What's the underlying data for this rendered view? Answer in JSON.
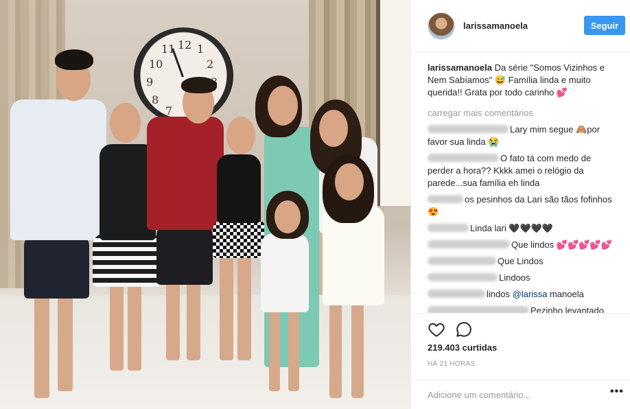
{
  "header": {
    "username": "larissamanoela",
    "follow_label": "Seguir"
  },
  "post": {
    "caption_user": "larissamanoela",
    "caption_text": "Da série \"Somos Vizinhos e Nem Sabíamos\" 😅 Família linda e muito querida!! Grata por todo carinho 💕",
    "load_more": "carregar mais comentários",
    "comments": [
      {
        "text": "Lary mim segue 🙈por favor sua linda 😭"
      },
      {
        "text": "O fato tá com medo de perder a hora?? Kkkk amei o relógio da parede...sua família eh linda"
      },
      {
        "text": "os pesinhos da Lari são tãos fofinhos 😍"
      },
      {
        "text": "Linda lari 🖤🖤🖤🖤"
      },
      {
        "text": "Que lindos 💕💕💕💕💕"
      },
      {
        "text": "Que Lindos"
      },
      {
        "text": "Lindoos"
      },
      {
        "text_before": "lindos ",
        "mention": "@larissa",
        "text_after": " manoela"
      },
      {
        "text": "Pezinho levantado"
      }
    ]
  },
  "actions": {
    "likes": "219.403 curtidas",
    "time": "HÁ 21 HORAS",
    "comment_placeholder": "Adicione um comentário...",
    "more": "•••"
  },
  "photo": {
    "clock_numbers": [
      "11",
      "12",
      "1",
      "10",
      "2",
      "9",
      "3",
      "8",
      "7"
    ]
  },
  "colors": {
    "accent": "#3897f0",
    "text": "#262626",
    "muted": "#999999",
    "divider": "#efefef"
  },
  "icons": [
    "heart-icon",
    "comment-bubble-icon",
    "more-options-icon"
  ]
}
